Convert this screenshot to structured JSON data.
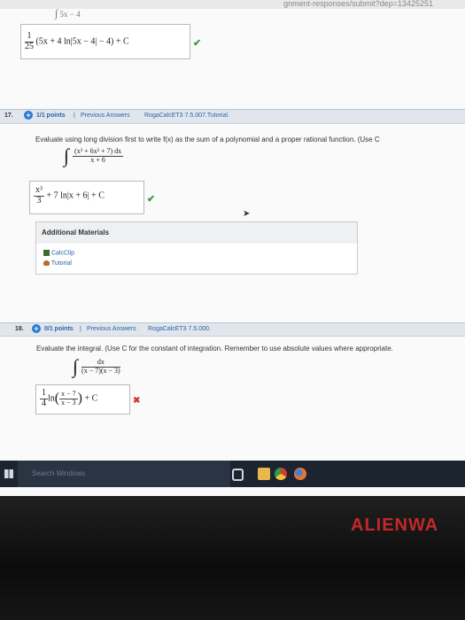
{
  "url_fragment": "gnment-responses/submit?dep=13425251",
  "top_residual": "5x − 4",
  "q16_answer": {
    "coef_num": "1",
    "coef_den": "25",
    "expr": "(5x + 4 ln|5x − 4| − 4) + C",
    "status": "✔"
  },
  "q17": {
    "number": "17.",
    "points": "1/1 points",
    "separator": "|",
    "prev_answers": "Previous Answers",
    "ref": "RogaCalcET3 7.5.007.Tutorial.",
    "prompt": "Evaluate using long division first to write f(x) as the sum of a polynomial and a proper rational function. (Use C",
    "integral_num": "(x³ + 6x² + 7) dx",
    "integral_den": "x + 6",
    "answer_num": "x³",
    "answer_den": "3",
    "answer_rest": "+ 7 ln|x + 6| + C",
    "status": "✔"
  },
  "additional_materials": {
    "title": "Additional Materials",
    "links": [
      "CalcClip",
      "Tutorial"
    ]
  },
  "q18": {
    "number": "18.",
    "points": "0/1 points",
    "separator": "|",
    "prev_answers": "Previous Answers",
    "ref": "RogaCalcET3 7.5.000.",
    "prompt": "Evaluate the integral. (Use C for the constant of integration. Remember to use absolute values where appropriate.",
    "integral_num": "dx",
    "integral_den": "(x − 7)(x − 3)",
    "answer_coef_num": "1",
    "answer_coef_den": "4",
    "answer_ln": "ln",
    "answer_frac_num": "x − 7",
    "answer_frac_den": "x − 3",
    "answer_rest": "+ C",
    "status": "✖"
  },
  "taskbar": {
    "search_placeholder": "Search Windows"
  },
  "brand": "ALIENWA"
}
